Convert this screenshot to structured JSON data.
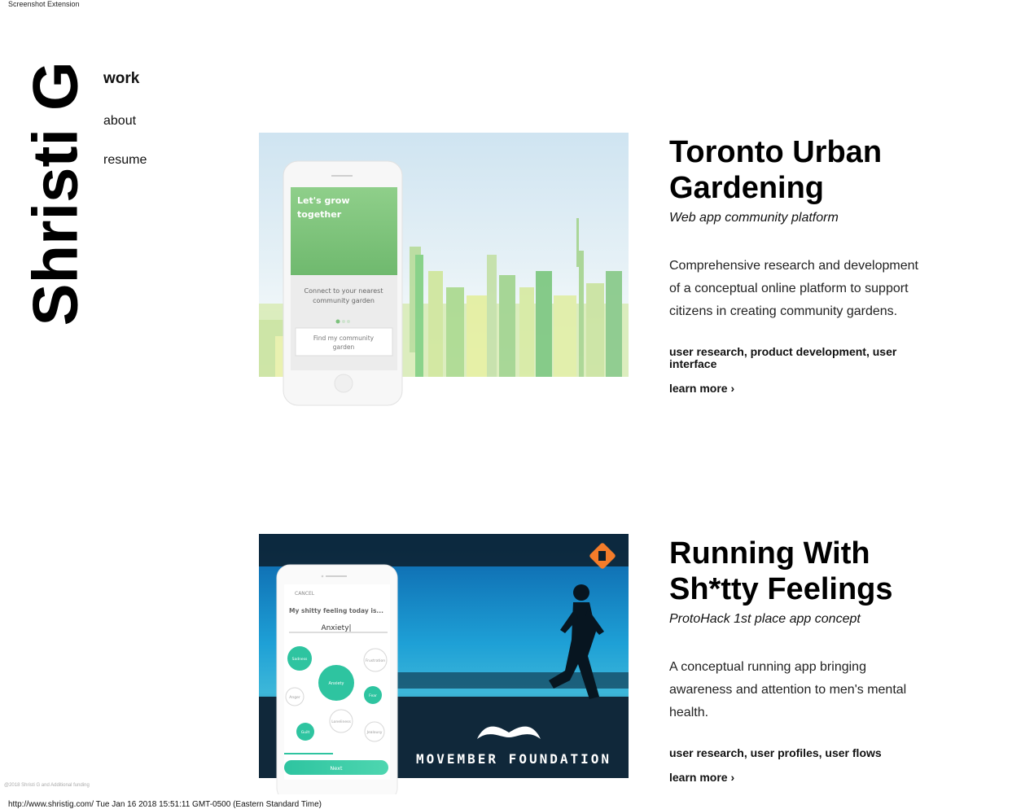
{
  "extension_label": "Screenshot Extension",
  "logo": "Shristi G",
  "nav": {
    "work": "work",
    "about": "about",
    "resume": "resume"
  },
  "projects": [
    {
      "title_line1": "Toronto Urban",
      "title_line2": "Gardening",
      "subtitle": "Web app community platform",
      "description": "Comprehensive research and development of a conceptual online platform to support citizens in creating community gardens.",
      "tags": "user research, product development, user interface",
      "learn_more": "learn more ›",
      "phone_heading_line1": "Let's grow",
      "phone_heading_line2": "together",
      "phone_body_line1": "Connect to your nearest",
      "phone_body_line2": "community garden",
      "phone_button_line1": "Find my community",
      "phone_button_line2": "garden"
    },
    {
      "title_line1": "Running With",
      "title_line2": "Sh*tty Feelings",
      "subtitle": "ProtoHack 1st place app concept",
      "description": "A conceptual running app bringing awareness and attention to men's mental health.",
      "tags": "user research, user profiles, user flows",
      "learn_more": "learn more ›",
      "phone_cancel": "CANCEL",
      "phone_question": "My shitty feeling today is...",
      "phone_input": "Anxiety|",
      "phone_bubbles": [
        "Sadness",
        "Frustration",
        "Anxiety",
        "Anger",
        "Fear",
        "Loneliness",
        "Guilt",
        "Jealousy"
      ],
      "phone_next": "Next",
      "banner": "MOVEMBER FOUNDATION"
    }
  ],
  "copyright": "@2018 Shristi G and Additional funding",
  "footer_url": "http://www.shristig.com/ Tue Jan 16 2018 15:51:11 GMT-0500 (Eastern Standard Time)",
  "colors": {
    "accent_green": "#7dc27d",
    "teal": "#2ec4a0",
    "sky_blue": "#1f9fd3",
    "text": "#111111"
  }
}
